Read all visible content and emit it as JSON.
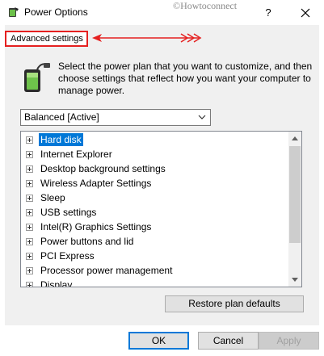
{
  "window": {
    "title": "Power Options",
    "watermark": "©Howtoconnect",
    "help_label": "?",
    "app_icon": "power-options-icon",
    "close_icon": "close-icon"
  },
  "tab": {
    "label": "Advanced settings"
  },
  "annotation": {
    "color": "#e52020"
  },
  "description": "Select the power plan that you want to customize, and then choose settings that reflect how you want your computer to manage power.",
  "plan_select": {
    "value": "Balanced [Active]"
  },
  "tree": {
    "items": [
      {
        "label": "Hard disk",
        "selected": true
      },
      {
        "label": "Internet Explorer"
      },
      {
        "label": "Desktop background settings"
      },
      {
        "label": "Wireless Adapter Settings"
      },
      {
        "label": "Sleep"
      },
      {
        "label": "USB settings"
      },
      {
        "label": "Intel(R) Graphics Settings"
      },
      {
        "label": "Power buttons and lid"
      },
      {
        "label": "PCI Express"
      },
      {
        "label": "Processor power management"
      },
      {
        "label": "Display"
      }
    ]
  },
  "buttons": {
    "restore": "Restore plan defaults",
    "ok": "OK",
    "cancel": "Cancel",
    "apply": "Apply"
  },
  "colors": {
    "selection": "#0078d7",
    "accent": "#0078d7"
  }
}
